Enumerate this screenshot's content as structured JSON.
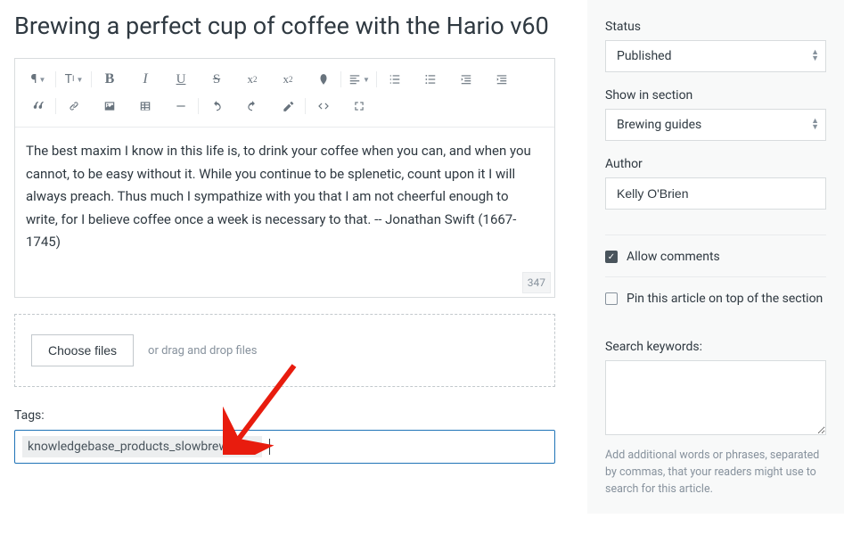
{
  "title": "Brewing a perfect cup of coffee with the Hario v60",
  "editor": {
    "body": "The best maxim I know in this life is, to drink your coffee when you can, and when you cannot, to be easy without it. While you continue to be splenetic, count upon it I will always preach. Thus much I sympathize with you that I am not cheerful enough to write, for I believe coffee once a week is necessary to that.  -- Jonathan Swift (1667-1745)",
    "word_count": "347"
  },
  "dropzone": {
    "button": "Choose files",
    "hint": "or drag and drop files"
  },
  "tags": {
    "label": "Tags:",
    "chip": "knowledgebase_products_slowbrewers",
    "chip_remove": "×"
  },
  "sidebar": {
    "status_label": "Status",
    "status_value": "Published",
    "section_label": "Show in section",
    "section_value": "Brewing guides",
    "author_label": "Author",
    "author_value": "Kelly O'Brien",
    "allow_comments": "Allow comments",
    "pin_article": "Pin this article on top of the section",
    "keywords_label": "Search keywords:",
    "keywords_help": "Add additional words or phrases, separated by commas, that your readers might use to search for this article."
  }
}
